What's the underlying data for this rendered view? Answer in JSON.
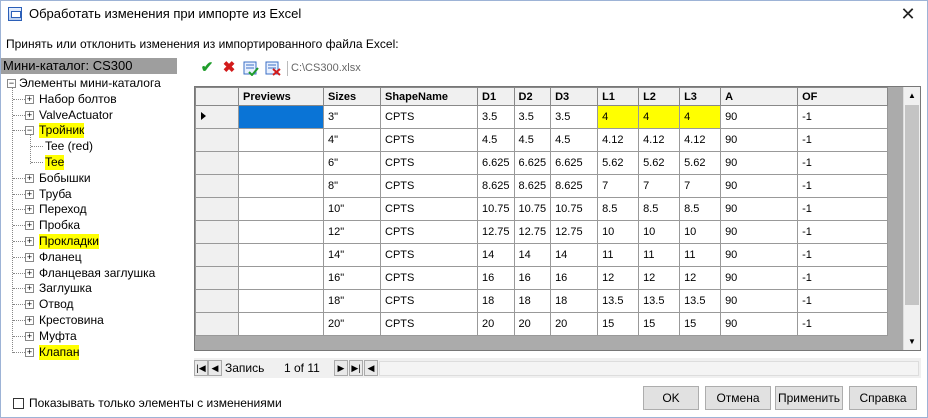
{
  "window": {
    "title": "Обработать изменения при импорте из Excel",
    "close_glyph": "✕"
  },
  "prompt": "Принять или отклонить изменения из импортированного файла Excel:",
  "left_panel": {
    "header": "Мини-каталог: CS300",
    "tree": {
      "root": "Элементы мини-каталога",
      "items": [
        {
          "label": "Набор болтов",
          "highlight": false
        },
        {
          "label": "ValveActuator",
          "highlight": false
        },
        {
          "label": "Тройник",
          "highlight": true,
          "expanded": true,
          "children": [
            {
              "label": "Tee (red)",
              "highlight": false
            },
            {
              "label": "Tee",
              "highlight": true
            }
          ]
        },
        {
          "label": "Бобышки",
          "highlight": false
        },
        {
          "label": "Труба",
          "highlight": false
        },
        {
          "label": "Переход",
          "highlight": false
        },
        {
          "label": "Пробка",
          "highlight": false
        },
        {
          "label": "Прокладки",
          "highlight": true
        },
        {
          "label": "Фланец",
          "highlight": false
        },
        {
          "label": "Фланцевая заглушка",
          "highlight": false
        },
        {
          "label": "Заглушка",
          "highlight": false
        },
        {
          "label": "Отвод",
          "highlight": false
        },
        {
          "label": "Крестовина",
          "highlight": false
        },
        {
          "label": "Муфта",
          "highlight": false
        },
        {
          "label": "Клапан",
          "highlight": true
        }
      ]
    }
  },
  "toolbar": {
    "icons": [
      "accept-icon",
      "reject-icon",
      "accept-all-icon",
      "reject-all-icon"
    ],
    "file_path": "C:\\CS300.xlsx"
  },
  "grid": {
    "columns": [
      "",
      "Previews",
      "Sizes",
      "ShapeName",
      "D1",
      "D2",
      "D3",
      "L1",
      "L2",
      "L3",
      "A",
      "OF"
    ],
    "rows": [
      [
        "",
        "",
        "3\"",
        "CPTS",
        "3.5",
        "3.5",
        "3.5",
        "4",
        "4",
        "4",
        "90",
        "-1"
      ],
      [
        "",
        "",
        "4\"",
        "CPTS",
        "4.5",
        "4.5",
        "4.5",
        "4.12",
        "4.12",
        "4.12",
        "90",
        "-1"
      ],
      [
        "",
        "",
        "6\"",
        "CPTS",
        "6.625",
        "6.625",
        "6.625",
        "5.62",
        "5.62",
        "5.62",
        "90",
        "-1"
      ],
      [
        "",
        "",
        "8\"",
        "CPTS",
        "8.625",
        "8.625",
        "8.625",
        "7",
        "7",
        "7",
        "90",
        "-1"
      ],
      [
        "",
        "",
        "10\"",
        "CPTS",
        "10.75",
        "10.75",
        "10.75",
        "8.5",
        "8.5",
        "8.5",
        "90",
        "-1"
      ],
      [
        "",
        "",
        "12\"",
        "CPTS",
        "12.75",
        "12.75",
        "12.75",
        "10",
        "10",
        "10",
        "90",
        "-1"
      ],
      [
        "",
        "",
        "14\"",
        "CPTS",
        "14",
        "14",
        "14",
        "11",
        "11",
        "11",
        "90",
        "-1"
      ],
      [
        "",
        "",
        "16\"",
        "CPTS",
        "16",
        "16",
        "16",
        "12",
        "12",
        "12",
        "90",
        "-1"
      ],
      [
        "",
        "",
        "18\"",
        "CPTS",
        "18",
        "18",
        "18",
        "13.5",
        "13.5",
        "13.5",
        "90",
        "-1"
      ],
      [
        "",
        "",
        "20\"",
        "CPTS",
        "20",
        "20",
        "20",
        "15",
        "15",
        "15",
        "90",
        "-1"
      ]
    ],
    "highlighted_cells": [
      [
        0,
        7
      ],
      [
        0,
        8
      ],
      [
        0,
        9
      ]
    ],
    "highlight_color": "#ffff00",
    "selection_color": "#0a74d6"
  },
  "navigator": {
    "record_label": "Запись",
    "position": "1 of 11"
  },
  "footer": {
    "checkbox_label": "Показывать только элементы с изменениями",
    "buttons": {
      "ok": "OK",
      "cancel": "Отмена",
      "apply": "Применить",
      "help": "Справка"
    }
  }
}
